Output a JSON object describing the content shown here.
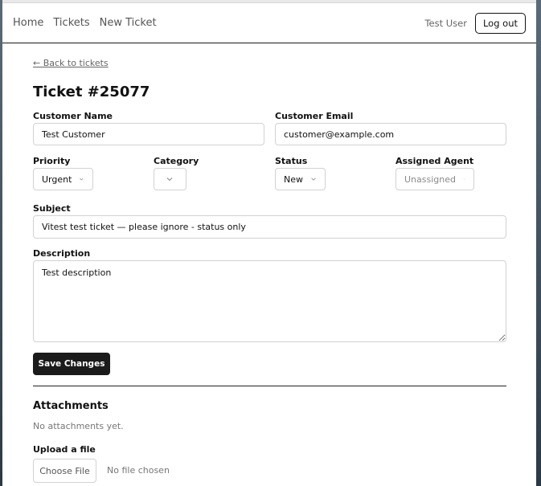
{
  "nav": {
    "links": [
      "Home",
      "Tickets",
      "New Ticket"
    ],
    "user": "Test User",
    "logout_label": "Log out"
  },
  "page": {
    "back_link": "← Back to tickets",
    "title": "Ticket #25077"
  },
  "form": {
    "customer_name": {
      "label": "Customer Name",
      "value": "Test Customer"
    },
    "customer_email": {
      "label": "Customer Email",
      "value": "customer@example.com"
    },
    "priority": {
      "label": "Priority",
      "value": "Urgent"
    },
    "category": {
      "label": "Category",
      "value": ""
    },
    "status": {
      "label": "Status",
      "value": "New"
    },
    "assigned_agent": {
      "label": "Assigned Agent",
      "value": "Unassigned"
    },
    "subject": {
      "label": "Subject",
      "value": "Vitest test ticket — please ignore - status only"
    },
    "description": {
      "label": "Description",
      "value": "Test description"
    },
    "save_label": "Save Changes"
  },
  "attachments": {
    "heading": "Attachments",
    "empty_text": "No attachments yet.",
    "upload_label": "Upload a file",
    "choose_label": "Choose File",
    "no_file_text": "No file chosen"
  }
}
